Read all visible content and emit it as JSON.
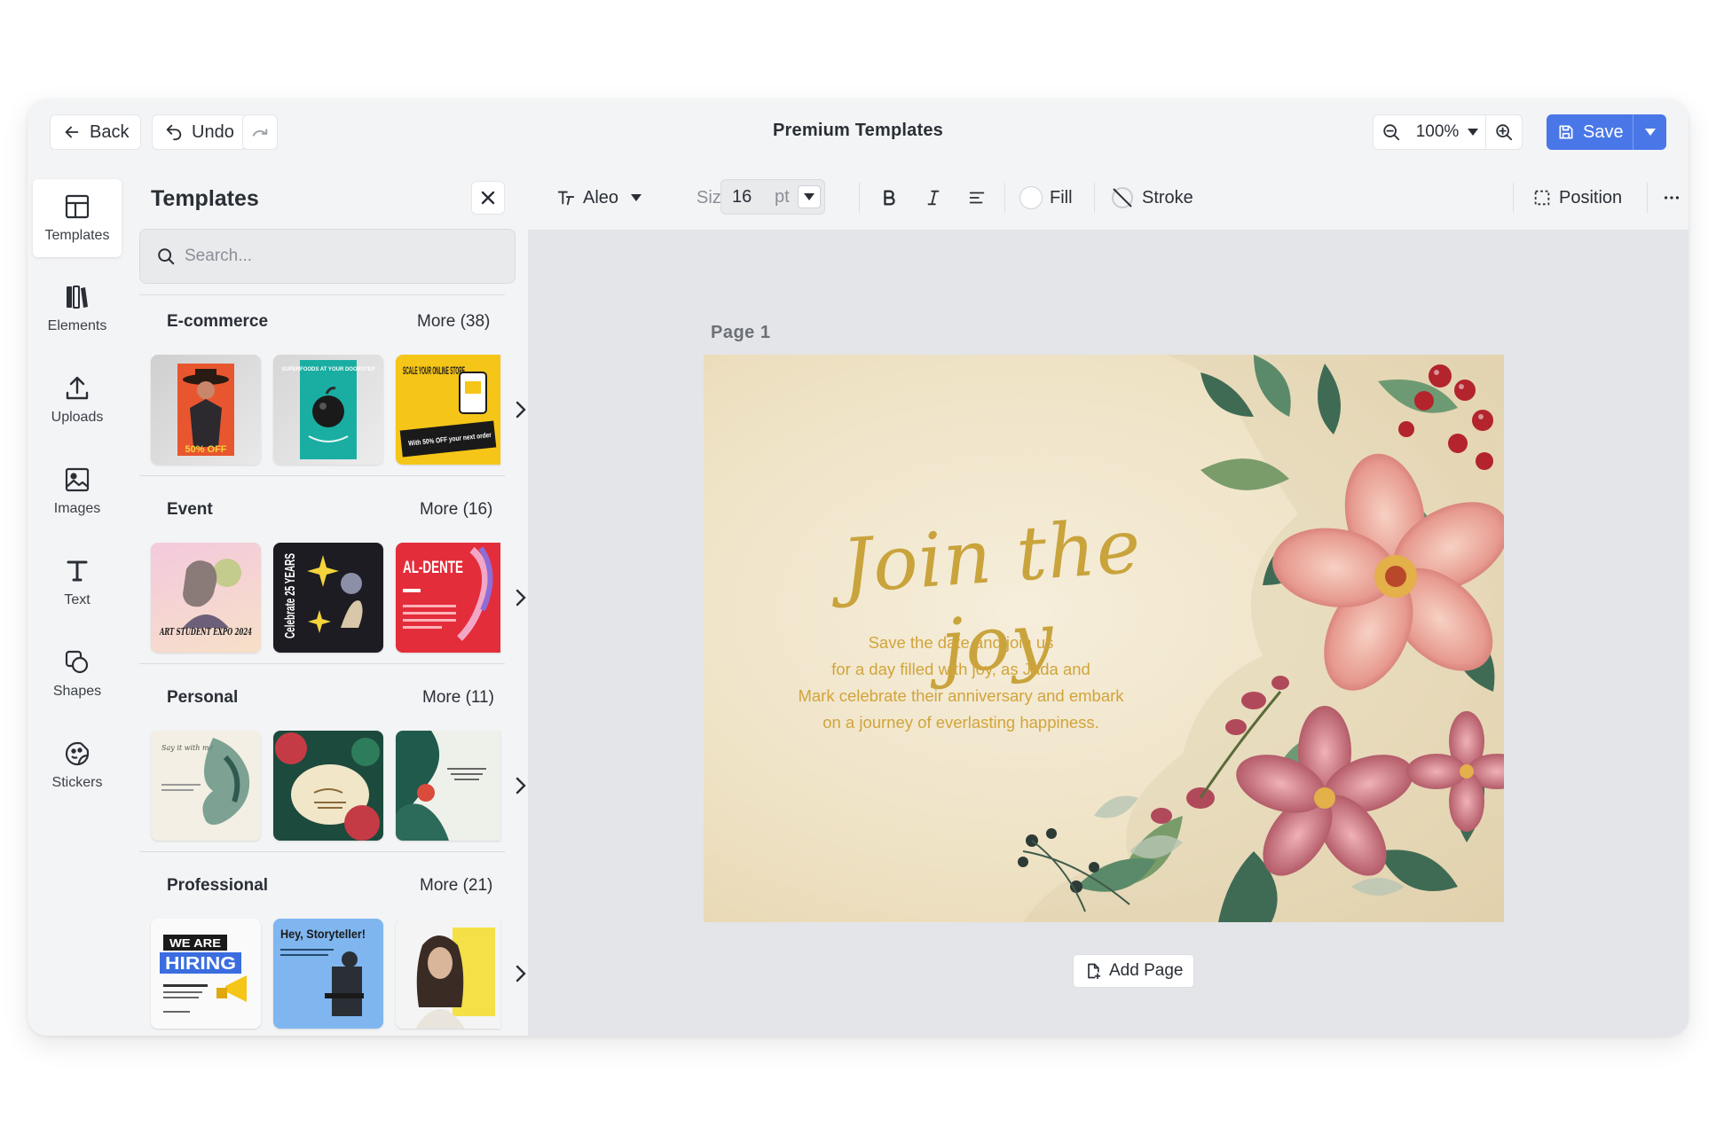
{
  "header": {
    "back_label": "Back",
    "undo_label": "Undo",
    "title": "Premium Templates",
    "zoom": "100%",
    "save_label": "Save"
  },
  "rail": {
    "items": [
      {
        "label": "Templates",
        "icon": "layout-icon"
      },
      {
        "label": "Elements",
        "icon": "elements-icon"
      },
      {
        "label": "Uploads",
        "icon": "upload-icon"
      },
      {
        "label": "Images",
        "icon": "image-icon"
      },
      {
        "label": "Text",
        "icon": "text-icon"
      },
      {
        "label": "Shapes",
        "icon": "shapes-icon"
      },
      {
        "label": "Stickers",
        "icon": "sticker-icon"
      }
    ]
  },
  "panel": {
    "title": "Templates",
    "search_placeholder": "Search...",
    "categories": [
      {
        "name": "E-commerce",
        "more": "More (38)"
      },
      {
        "name": "Event",
        "more": "More (16)"
      },
      {
        "name": "Personal",
        "more": "More (11)"
      },
      {
        "name": "Professional",
        "more": "More (21)"
      }
    ]
  },
  "toolbar": {
    "font": "Aleo",
    "size_label": "Size",
    "size_value": "16",
    "size_unit": "pt",
    "fill_label": "Fill",
    "stroke_label": "Stroke",
    "position_label": "Position"
  },
  "canvas": {
    "page_label": "Page  1",
    "headline": "Join the joy",
    "body_lines": [
      "Save the date and join us",
      "for a day filled with joy, as Jada and",
      "Mark celebrate their anniversary and embark",
      "on a journey of everlasting happiness."
    ],
    "add_page_label": "Add Page"
  },
  "thumbnails": {
    "ecommerce_1": "50% OFF",
    "ecommerce_2": "SUPERFOODS AT YOUR DOORSTEP",
    "ecommerce_3_a": "SCALE YOUR ONLINE STORE",
    "ecommerce_3_b": "With 50% OFF your next order",
    "event_1": "ART STUDENT EXPO 2024",
    "event_2": "Celebrate 25 YEARS",
    "event_3": "AL-DENTE",
    "personal_1": "Say it with me",
    "professional_1_a": "WE ARE",
    "professional_1_b": "HIRING",
    "professional_2": "Hey, Storyteller!"
  },
  "colors": {
    "accent": "#4a77e8",
    "headline_gold": "#c9a33c",
    "body_gold": "#d1a43a"
  }
}
